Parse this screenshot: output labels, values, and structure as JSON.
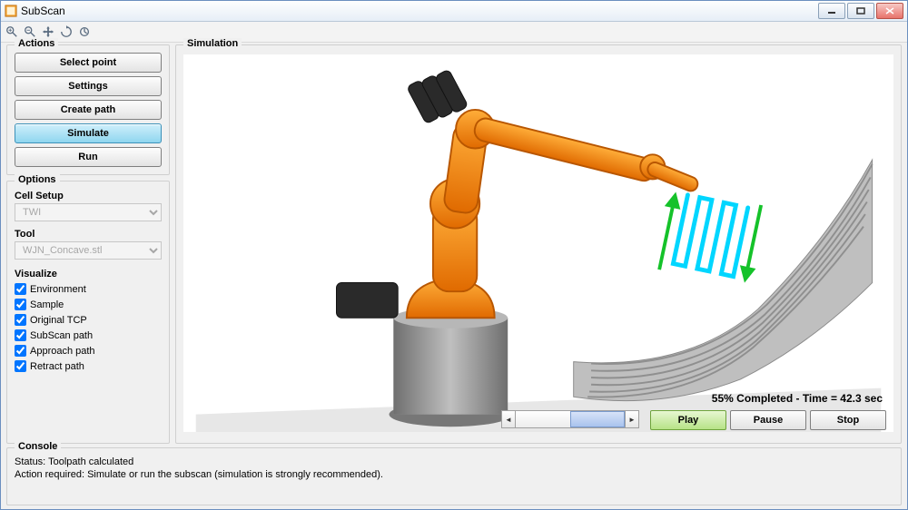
{
  "window": {
    "title": "SubScan"
  },
  "toolbar": {
    "icons": [
      "zoom-in-icon",
      "zoom-out-icon",
      "pan-icon",
      "rotate-icon",
      "home-icon"
    ]
  },
  "actions": {
    "legend": "Actions",
    "buttons": [
      {
        "id": "select-point",
        "label": "Select point",
        "active": false
      },
      {
        "id": "settings",
        "label": "Settings",
        "active": false
      },
      {
        "id": "create-path",
        "label": "Create path",
        "active": false
      },
      {
        "id": "simulate",
        "label": "Simulate",
        "active": true
      },
      {
        "id": "run",
        "label": "Run",
        "active": false
      }
    ]
  },
  "options": {
    "legend": "Options",
    "cell_setup": {
      "label": "Cell Setup",
      "value": "TWI"
    },
    "tool": {
      "label": "Tool",
      "value": "WJN_Concave.stl"
    },
    "visualize_label": "Visualize",
    "visualize": [
      {
        "id": "env",
        "label": "Environment",
        "checked": true
      },
      {
        "id": "sample",
        "label": "Sample",
        "checked": true
      },
      {
        "id": "origtcp",
        "label": "Original TCP",
        "checked": true
      },
      {
        "id": "subscan",
        "label": "SubScan path",
        "checked": true
      },
      {
        "id": "approach",
        "label": "Approach path",
        "checked": true
      },
      {
        "id": "retract",
        "label": "Retract path",
        "checked": true
      }
    ]
  },
  "simulation": {
    "legend": "Simulation",
    "progress_percent": 55,
    "time_sec": 42.3,
    "status_text": "55% Completed - Time = 42.3 sec",
    "controls": {
      "play": "Play",
      "pause": "Pause",
      "stop": "Stop"
    }
  },
  "console": {
    "legend": "Console",
    "line1": "Status: Toolpath calculated",
    "line2": "Action required: Simulate or run the subscan (simulation is strongly recommended)."
  }
}
